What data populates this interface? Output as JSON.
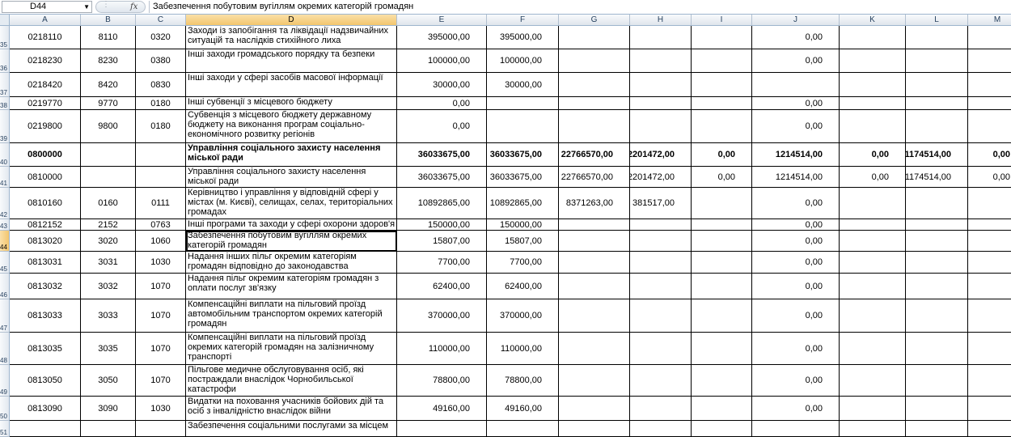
{
  "formula_bar": {
    "name_box": "D44",
    "fx": "fx",
    "content": "Забезпечення побутовим вугіллям окремих категорій громадян"
  },
  "columns": [
    "A",
    "B",
    "C",
    "D",
    "E",
    "F",
    "G",
    "H",
    "I",
    "J",
    "K",
    "L",
    "M"
  ],
  "selected_column": "D",
  "selected_row": "44",
  "rows": [
    {
      "num": "35",
      "cells": [
        "0218110",
        "8110",
        "0320",
        "Заходи із запобігання та ліквідації надзвичайних ситуацій та наслідків стихійного лиха",
        "395000,00",
        "395000,00",
        "",
        "",
        "",
        "0,00",
        "",
        "",
        ""
      ]
    },
    {
      "num": "36",
      "cells": [
        "0218230",
        "8230",
        "0380",
        "Інші заходи громадського порядку та безпеки",
        "100000,00",
        "100000,00",
        "",
        "",
        "",
        "0,00",
        "",
        "",
        ""
      ]
    },
    {
      "num": "37",
      "cells": [
        "0218420",
        "8420",
        "0830",
        "Інші заходи у сфері засобів масової інформації",
        "30000,00",
        "30000,00",
        "",
        "",
        "",
        "",
        "",
        "",
        ""
      ]
    },
    {
      "num": "38",
      "cells": [
        "0219770",
        "9770",
        "0180",
        "Інші субвенції з місцевого бюджету",
        "0,00",
        "",
        "",
        "",
        "",
        "0,00",
        "",
        "",
        ""
      ]
    },
    {
      "num": "39",
      "cells": [
        "0219800",
        "9800",
        "0180",
        "Субвенція з місцевого бюджету державному бюджету на виконання програм соціально-економічного розвитку регіонів",
        "0,00",
        "",
        "",
        "",
        "",
        "0,00",
        "",
        "",
        ""
      ]
    },
    {
      "num": "40",
      "bold": true,
      "cells": [
        "0800000",
        "",
        "",
        "Управління соціального захисту населення міської ради",
        "36033675,00",
        "36033675,00",
        "22766570,00",
        "2201472,00",
        "0,00",
        "1214514,00",
        "0,00",
        "1174514,00",
        "0,00"
      ]
    },
    {
      "num": "41",
      "cells": [
        "0810000",
        "",
        "",
        "Управління соціального захисту населення міської ради",
        "36033675,00",
        "36033675,00",
        "22766570,00",
        "2201472,00",
        "0,00",
        "1214514,00",
        "0,00",
        "1174514,00",
        "0,00"
      ]
    },
    {
      "num": "42",
      "cells": [
        "0810160",
        "0160",
        "0111",
        "Керівництво і управління у відповідній сфері у містах (м. Києві), селищах, селах, територіальних громадах",
        "10892865,00",
        "10892865,00",
        "8371263,00",
        "381517,00",
        "",
        "0,00",
        "",
        "",
        ""
      ]
    },
    {
      "num": "43",
      "cells": [
        "0812152",
        "2152",
        "0763",
        "Інші програми та заходи у сфері охорони здоров'я",
        "150000,00",
        "150000,00",
        "",
        "",
        "",
        "0,00",
        "",
        "",
        ""
      ]
    },
    {
      "num": "44",
      "cells": [
        "0813020",
        "3020",
        "1060",
        "Забезпечення побутовим вугіллям окремих категорій громадян",
        "15807,00",
        "15807,00",
        "",
        "",
        "",
        "0,00",
        "",
        "",
        ""
      ]
    },
    {
      "num": "45",
      "cells": [
        "0813031",
        "3031",
        "1030",
        "Надання інших пільг окремим категоріям громадян відповідно до законодавства",
        "7700,00",
        "7700,00",
        "",
        "",
        "",
        "0,00",
        "",
        "",
        ""
      ]
    },
    {
      "num": "46",
      "cells": [
        "0813032",
        "3032",
        "1070",
        "Надання пільг окремим категоріям громадян з оплати послуг зв'язку",
        "62400,00",
        "62400,00",
        "",
        "",
        "",
        "0,00",
        "",
        "",
        ""
      ]
    },
    {
      "num": "47",
      "cells": [
        "0813033",
        "3033",
        "1070",
        "Компенсаційні виплати на пільговий проїзд автомобільним транспортом  окремих категорій громадян",
        "370000,00",
        "370000,00",
        "",
        "",
        "",
        "0,00",
        "",
        "",
        ""
      ]
    },
    {
      "num": "48",
      "cells": [
        "0813035",
        "3035",
        "1070",
        "Компенсаційні виплати на пільговий проїзд окремих категорій громадян на залізничному транспорті",
        "110000,00",
        "110000,00",
        "",
        "",
        "",
        "0,00",
        "",
        "",
        ""
      ]
    },
    {
      "num": "49",
      "cells": [
        "0813050",
        "3050",
        "1070",
        "Пільгове  медичне обслуговування осіб, які постраждали внаслідок Чорнобильської катастрофи",
        "78800,00",
        "78800,00",
        "",
        "",
        "",
        "0,00",
        "",
        "",
        ""
      ]
    },
    {
      "num": "50",
      "cells": [
        "0813090",
        "3090",
        "1030",
        "Видатки на поховання учасників бойових дій та осіб з інвалідністю внаслідок війни",
        "49160,00",
        "49160,00",
        "",
        "",
        "",
        "0,00",
        "",
        "",
        ""
      ]
    },
    {
      "num": "51",
      "cells": [
        "",
        "",
        "",
        "Забезпечення соціальними послугами за місцем",
        "",
        "",
        "",
        "",
        "",
        "",
        "",
        "",
        ""
      ]
    }
  ]
}
